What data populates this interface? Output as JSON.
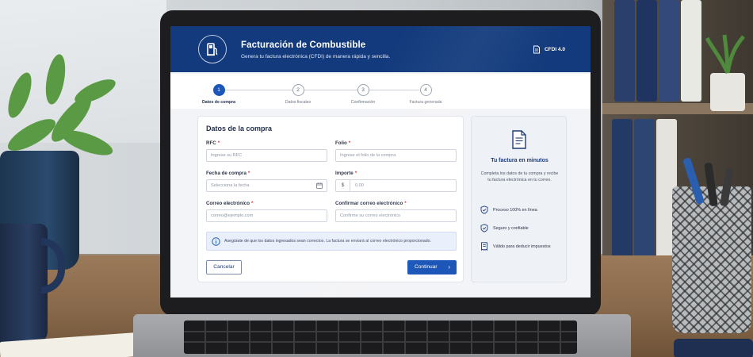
{
  "header": {
    "title": "Facturación de Combustible",
    "subtitle": "Genera tu factura electrónica (CFDI) de manera rápida y sencilla.",
    "cfdi_badge": "CFDI 4.0",
    "logo_icon": "fuel-pump-icon",
    "color": "#123a7c"
  },
  "stepper": {
    "active_step": 1,
    "steps": [
      {
        "number": "1",
        "label": "Datos de compra"
      },
      {
        "number": "2",
        "label": "Datos fiscales"
      },
      {
        "number": "3",
        "label": "Confirmación"
      },
      {
        "number": "4",
        "label": "Factura generada"
      }
    ]
  },
  "form": {
    "title": "Datos de la compra",
    "required_mark": "*",
    "rfc": {
      "label": "RFC",
      "placeholder": "Ingrese su RFC"
    },
    "folio": {
      "label": "Folio",
      "placeholder": "Ingrese el folio de la compra"
    },
    "fecha": {
      "label": "Fecha de compra",
      "placeholder": "Selecciona la fecha",
      "icon": "calendar-icon"
    },
    "importe": {
      "label": "Importe",
      "currency": "$",
      "placeholder": "0.00"
    },
    "correo": {
      "label": "Correo electrónico",
      "placeholder": "correo@ejemplo.com"
    },
    "confirmar_correo": {
      "label": "Confirmar correo electrónico",
      "placeholder": "Confirme su correo electrónico"
    },
    "info": "Asegúrate de que los datos ingresados sean correctos. La factura se enviará al correo electrónico proporcionado.",
    "cancel_label": "Cancelar",
    "continue_label": "Continuar",
    "accent": "#1b56b8"
  },
  "side": {
    "title": "Tu factura en minutos",
    "description": "Completa los datos de tu compra y recibe tu factura electrónica en tu correo.",
    "benefits": [
      {
        "icon": "shield-check-icon",
        "label": "Proceso 100% en línea"
      },
      {
        "icon": "shield-check-icon",
        "label": "Seguro y confiable"
      },
      {
        "icon": "receipt-icon",
        "label": "Válido para deducir impuestos"
      }
    ]
  }
}
